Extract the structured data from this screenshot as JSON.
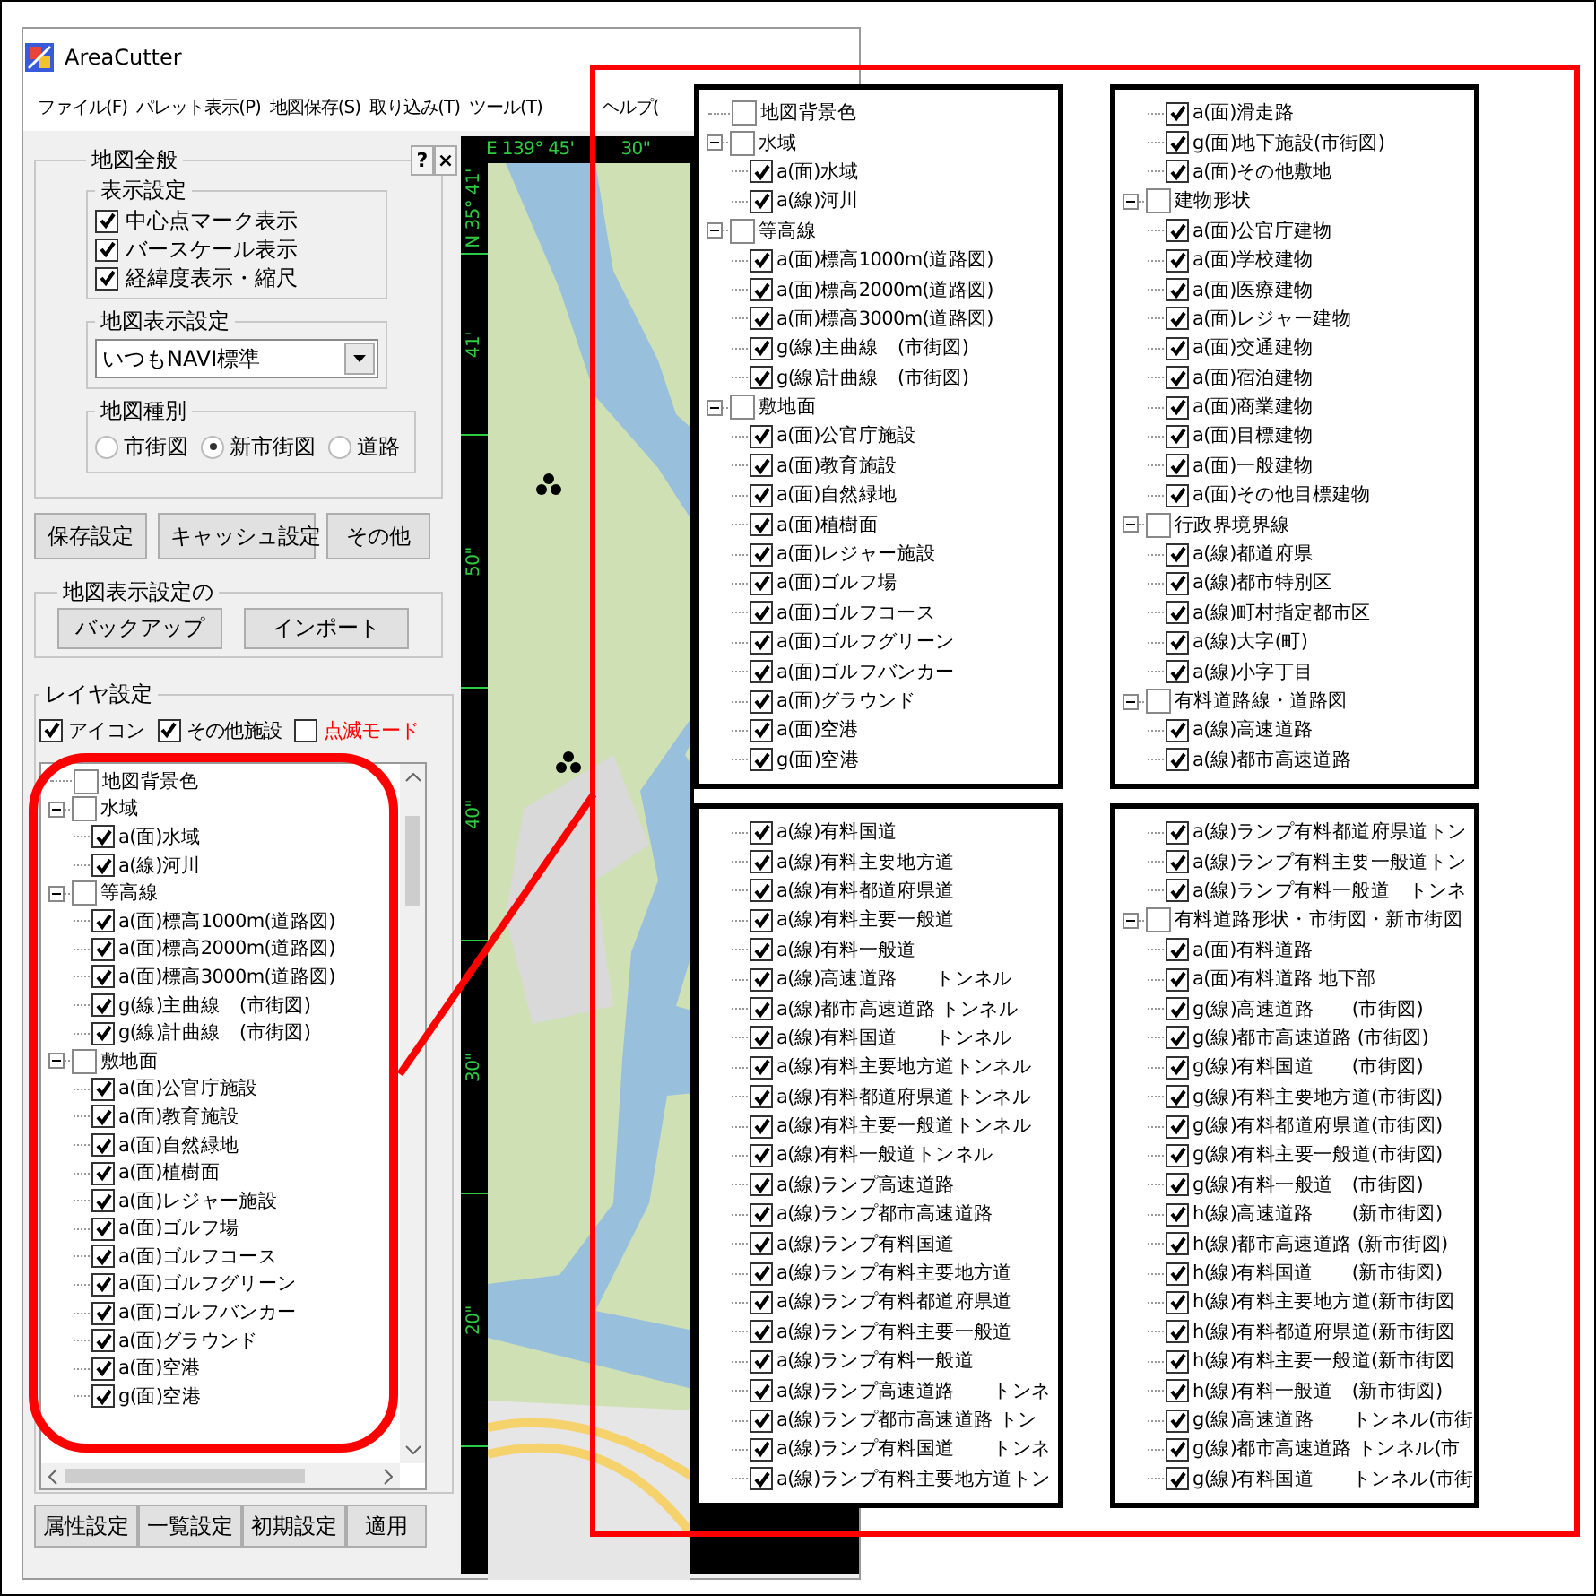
{
  "window": {
    "title": "AreaCutter"
  },
  "menu": [
    "ファイル(F)",
    "パレット表示(P)",
    "地図保存(S)",
    "取り込み(T)",
    "ツール(T)",
    "ヘルプ("
  ],
  "map_general": {
    "title": "地図全般",
    "help_button": "?",
    "close_button": "×",
    "display_settings": {
      "title": "表示設定",
      "options": [
        {
          "label": "中心点マーク表示",
          "checked": true
        },
        {
          "label": "バースケール表示",
          "checked": true
        },
        {
          "label": "経緯度表示・縮尺",
          "checked": true
        }
      ]
    },
    "map_display_setting": {
      "title": "地図表示設定",
      "value": "いつもNAVI標準"
    },
    "map_type": {
      "title": "地図種別",
      "options": [
        {
          "label": "市街図",
          "selected": false
        },
        {
          "label": "新市街図",
          "selected": true
        },
        {
          "label": "道路",
          "selected": false
        }
      ]
    }
  },
  "settings_buttons": [
    "保存設定",
    "キャッシュ設定",
    "その他"
  ],
  "backup_group": {
    "title": "地図表示設定の",
    "buttons": [
      "バックアップ",
      "インポート"
    ]
  },
  "layer_settings": {
    "title": "レイヤ設定",
    "options": [
      {
        "label": "アイコン",
        "checked": true,
        "color": "#000000"
      },
      {
        "label": "その他施設",
        "checked": true,
        "color": "#000000"
      },
      {
        "label": "点滅モード",
        "checked": false,
        "color": "#ff0000"
      }
    ],
    "tree": [
      {
        "kind": "group",
        "label": "地図背景色",
        "checked": false
      },
      {
        "kind": "group",
        "label": "水域",
        "checked": false,
        "children": [
          {
            "kind": "layer",
            "label": "a(面)水域",
            "checked": true
          },
          {
            "kind": "layer",
            "label": "a(線)河川",
            "checked": true
          }
        ]
      },
      {
        "kind": "group",
        "label": "等高線",
        "checked": false,
        "children": [
          {
            "kind": "layer",
            "label": "a(面)標高1000m(道路図)",
            "checked": true
          },
          {
            "kind": "layer",
            "label": "a(面)標高2000m(道路図)",
            "checked": true
          },
          {
            "kind": "layer",
            "label": "a(面)標高3000m(道路図)",
            "checked": true
          },
          {
            "kind": "layer",
            "label": "g(線)主曲線　(市街図)",
            "checked": true
          },
          {
            "kind": "layer",
            "label": "g(線)計曲線　(市街図)",
            "checked": true
          }
        ]
      },
      {
        "kind": "group",
        "label": "敷地面",
        "checked": false,
        "children": [
          {
            "kind": "layer",
            "label": "a(面)公官庁施設",
            "checked": true
          },
          {
            "kind": "layer",
            "label": "a(面)教育施設",
            "checked": true
          },
          {
            "kind": "layer",
            "label": "a(面)自然緑地",
            "checked": true
          },
          {
            "kind": "layer",
            "label": "a(面)植樹面",
            "checked": true
          },
          {
            "kind": "layer",
            "label": "a(面)レジャー施設",
            "checked": true
          },
          {
            "kind": "layer",
            "label": "a(面)ゴルフ場",
            "checked": true
          },
          {
            "kind": "layer",
            "label": "a(面)ゴルフコース",
            "checked": true
          },
          {
            "kind": "layer",
            "label": "a(面)ゴルフグリーン",
            "checked": true
          },
          {
            "kind": "layer",
            "label": "a(面)ゴルフバンカー",
            "checked": true
          },
          {
            "kind": "layer",
            "label": "a(面)グラウンド",
            "checked": true
          },
          {
            "kind": "layer",
            "label": "a(面)空港",
            "checked": true
          },
          {
            "kind": "layer",
            "label": "g(面)空港",
            "checked": true
          }
        ]
      }
    ]
  },
  "bottom_buttons": [
    "属性設定",
    "一覧設定",
    "初期設定",
    "適用"
  ],
  "map": {
    "top_ruler": [
      "E 139° 45'",
      "30\""
    ],
    "left_ruler": [
      "N 35° 41'",
      "41'",
      "50\"",
      "40\"",
      "30\"",
      "20\""
    ]
  },
  "zoom_panels": [
    {
      "items": [
        {
          "kind": "group",
          "label": "地図背景色",
          "checked": false
        },
        {
          "kind": "group",
          "label": "水域",
          "checked": false,
          "children": [
            {
              "kind": "layer",
              "label": "a(面)水域",
              "checked": true
            },
            {
              "kind": "layer",
              "label": "a(線)河川",
              "checked": true
            }
          ]
        },
        {
          "kind": "group",
          "label": "等高線",
          "checked": false,
          "children": [
            {
              "kind": "layer",
              "label": "a(面)標高1000m(道路図)",
              "checked": true
            },
            {
              "kind": "layer",
              "label": "a(面)標高2000m(道路図)",
              "checked": true
            },
            {
              "kind": "layer",
              "label": "a(面)標高3000m(道路図)",
              "checked": true
            },
            {
              "kind": "layer",
              "label": "g(線)主曲線　(市街図)",
              "checked": true
            },
            {
              "kind": "layer",
              "label": "g(線)計曲線　(市街図)",
              "checked": true
            }
          ]
        },
        {
          "kind": "group",
          "label": "敷地面",
          "checked": false,
          "children": [
            {
              "kind": "layer",
              "label": "a(面)公官庁施設",
              "checked": true
            },
            {
              "kind": "layer",
              "label": "a(面)教育施設",
              "checked": true
            },
            {
              "kind": "layer",
              "label": "a(面)自然緑地",
              "checked": true
            },
            {
              "kind": "layer",
              "label": "a(面)植樹面",
              "checked": true
            },
            {
              "kind": "layer",
              "label": "a(面)レジャー施設",
              "checked": true
            },
            {
              "kind": "layer",
              "label": "a(面)ゴルフ場",
              "checked": true
            },
            {
              "kind": "layer",
              "label": "a(面)ゴルフコース",
              "checked": true
            },
            {
              "kind": "layer",
              "label": "a(面)ゴルフグリーン",
              "checked": true
            },
            {
              "kind": "layer",
              "label": "a(面)ゴルフバンカー",
              "checked": true
            },
            {
              "kind": "layer",
              "label": "a(面)グラウンド",
              "checked": true
            },
            {
              "kind": "layer",
              "label": "a(面)空港",
              "checked": true
            },
            {
              "kind": "layer",
              "label": "g(面)空港",
              "checked": true
            }
          ]
        }
      ]
    },
    {
      "items": [
        {
          "kind": "layer",
          "label": "a(面)滑走路",
          "checked": true
        },
        {
          "kind": "layer",
          "label": "g(面)地下施設(市街図)",
          "checked": true
        },
        {
          "kind": "layer",
          "label": "a(面)その他敷地",
          "checked": true
        },
        {
          "kind": "group",
          "label": "建物形状",
          "checked": false,
          "children": [
            {
              "kind": "layer",
              "label": "a(面)公官庁建物",
              "checked": true
            },
            {
              "kind": "layer",
              "label": "a(面)学校建物",
              "checked": true
            },
            {
              "kind": "layer",
              "label": "a(面)医療建物",
              "checked": true
            },
            {
              "kind": "layer",
              "label": "a(面)レジャー建物",
              "checked": true
            },
            {
              "kind": "layer",
              "label": "a(面)交通建物",
              "checked": true
            },
            {
              "kind": "layer",
              "label": "a(面)宿泊建物",
              "checked": true
            },
            {
              "kind": "layer",
              "label": "a(面)商業建物",
              "checked": true
            },
            {
              "kind": "layer",
              "label": "a(面)目標建物",
              "checked": true
            },
            {
              "kind": "layer",
              "label": "a(面)一般建物",
              "checked": true
            },
            {
              "kind": "layer",
              "label": "a(面)その他目標建物",
              "checked": true
            }
          ]
        },
        {
          "kind": "group",
          "label": "行政界境界線",
          "checked": false,
          "children": [
            {
              "kind": "layer",
              "label": "a(線)都道府県",
              "checked": true
            },
            {
              "kind": "layer",
              "label": "a(線)都市特別区",
              "checked": true
            },
            {
              "kind": "layer",
              "label": "a(線)町村指定都市区",
              "checked": true
            },
            {
              "kind": "layer",
              "label": "a(線)大字(町)",
              "checked": true
            },
            {
              "kind": "layer",
              "label": "a(線)小字丁目",
              "checked": true
            }
          ]
        },
        {
          "kind": "group",
          "label": "有料道路線・道路図",
          "checked": false,
          "children": [
            {
              "kind": "layer",
              "label": "a(線)高速道路",
              "checked": true
            },
            {
              "kind": "layer",
              "label": "a(線)都市高速道路",
              "checked": true
            }
          ]
        }
      ]
    },
    {
      "items": [
        {
          "kind": "layer",
          "label": "a(線)有料国道",
          "checked": true
        },
        {
          "kind": "layer",
          "label": "a(線)有料主要地方道",
          "checked": true
        },
        {
          "kind": "layer",
          "label": "a(線)有料都道府県道",
          "checked": true
        },
        {
          "kind": "layer",
          "label": "a(線)有料主要一般道",
          "checked": true
        },
        {
          "kind": "layer",
          "label": "a(線)有料一般道",
          "checked": true
        },
        {
          "kind": "layer",
          "label": "a(線)高速道路　　トンネル",
          "checked": true
        },
        {
          "kind": "layer",
          "label": "a(線)都市高速道路 トンネル",
          "checked": true
        },
        {
          "kind": "layer",
          "label": "a(線)有料国道　　トンネル",
          "checked": true
        },
        {
          "kind": "layer",
          "label": "a(線)有料主要地方道トンネル",
          "checked": true
        },
        {
          "kind": "layer",
          "label": "a(線)有料都道府県道トンネル",
          "checked": true
        },
        {
          "kind": "layer",
          "label": "a(線)有料主要一般道トンネル",
          "checked": true
        },
        {
          "kind": "layer",
          "label": "a(線)有料一般道トンネル",
          "checked": true
        },
        {
          "kind": "layer",
          "label": "a(線)ランプ高速道路",
          "checked": true
        },
        {
          "kind": "layer",
          "label": "a(線)ランプ都市高速道路",
          "checked": true
        },
        {
          "kind": "layer",
          "label": "a(線)ランプ有料国道",
          "checked": true
        },
        {
          "kind": "layer",
          "label": "a(線)ランプ有料主要地方道",
          "checked": true
        },
        {
          "kind": "layer",
          "label": "a(線)ランプ有料都道府県道",
          "checked": true
        },
        {
          "kind": "layer",
          "label": "a(線)ランプ有料主要一般道",
          "checked": true
        },
        {
          "kind": "layer",
          "label": "a(線)ランプ有料一般道",
          "checked": true
        },
        {
          "kind": "layer",
          "label": "a(線)ランプ高速道路　　トンネ",
          "checked": true
        },
        {
          "kind": "layer",
          "label": "a(線)ランプ都市高速道路 トン",
          "checked": true
        },
        {
          "kind": "layer",
          "label": "a(線)ランプ有料国道　　トンネ",
          "checked": true
        },
        {
          "kind": "layer",
          "label": "a(線)ランプ有料主要地方道トン",
          "checked": true
        }
      ]
    },
    {
      "items": [
        {
          "kind": "layer",
          "label": "a(線)ランプ有料都道府県道トン",
          "checked": true
        },
        {
          "kind": "layer",
          "label": "a(線)ランプ有料主要一般道トン",
          "checked": true
        },
        {
          "kind": "layer",
          "label": "a(線)ランプ有料一般道　トンネ",
          "checked": true
        },
        {
          "kind": "group",
          "label": "有料道路形状・市街図・新市街図",
          "checked": false,
          "children": [
            {
              "kind": "layer",
              "label": "a(面)有料道路",
              "checked": true
            },
            {
              "kind": "layer",
              "label": "a(面)有料道路 地下部",
              "checked": true
            },
            {
              "kind": "layer",
              "label": "g(線)高速道路　　(市街図)",
              "checked": true
            },
            {
              "kind": "layer",
              "label": "g(線)都市高速道路 (市街図)",
              "checked": true
            },
            {
              "kind": "layer",
              "label": "g(線)有料国道　　(市街図)",
              "checked": true
            },
            {
              "kind": "layer",
              "label": "g(線)有料主要地方道(市街図)",
              "checked": true
            },
            {
              "kind": "layer",
              "label": "g(線)有料都道府県道(市街図)",
              "checked": true
            },
            {
              "kind": "layer",
              "label": "g(線)有料主要一般道(市街図)",
              "checked": true
            },
            {
              "kind": "layer",
              "label": "g(線)有料一般道　(市街図)",
              "checked": true
            },
            {
              "kind": "layer",
              "label": "h(線)高速道路　　(新市街図)",
              "checked": true
            },
            {
              "kind": "layer",
              "label": "h(線)都市高速道路 (新市街図)",
              "checked": true
            },
            {
              "kind": "layer",
              "label": "h(線)有料国道　　(新市街図)",
              "checked": true
            },
            {
              "kind": "layer",
              "label": "h(線)有料主要地方道(新市街図",
              "checked": true
            },
            {
              "kind": "layer",
              "label": "h(線)有料都道府県道(新市街図",
              "checked": true
            },
            {
              "kind": "layer",
              "label": "h(線)有料主要一般道(新市街図",
              "checked": true
            },
            {
              "kind": "layer",
              "label": "h(線)有料一般道　(新市街図)",
              "checked": true
            },
            {
              "kind": "layer",
              "label": "g(線)高速道路　　トンネル(市街",
              "checked": true
            },
            {
              "kind": "layer",
              "label": "g(線)都市高速道路 トンネル(市",
              "checked": true
            },
            {
              "kind": "layer",
              "label": "g(線)有料国道　　トンネル(市街",
              "checked": true
            }
          ]
        }
      ]
    }
  ]
}
